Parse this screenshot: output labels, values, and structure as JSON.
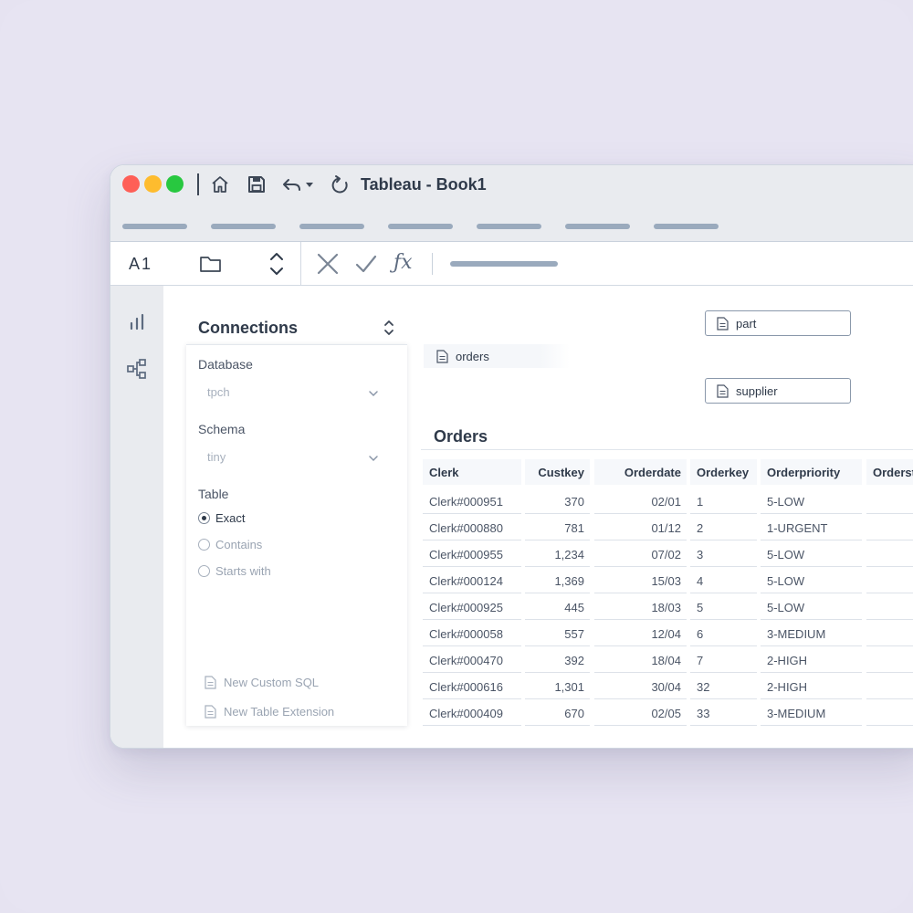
{
  "window": {
    "title": "Tableau - Book1"
  },
  "formula_bar": {
    "cell_ref": "A1",
    "fx_label": "ƒx"
  },
  "connections": {
    "title": "Connections",
    "database": {
      "label": "Database",
      "value": "tpch"
    },
    "schema": {
      "label": "Schema",
      "value": "tiny"
    },
    "table": {
      "label": "Table",
      "options": [
        {
          "label": "Exact",
          "checked": true
        },
        {
          "label": "Contains",
          "checked": false
        },
        {
          "label": "Starts with",
          "checked": false
        }
      ]
    },
    "new_custom_sql": "New Custom SQL",
    "new_table_extension": "New Table Extension"
  },
  "canvas": {
    "tables": {
      "part": "part",
      "orders": "orders",
      "supplier": "supplier"
    }
  },
  "grid": {
    "title": "Orders",
    "columns": [
      "Clerk",
      "Custkey",
      "Orderdate",
      "Orderkey",
      "Orderpriority",
      "Orderst"
    ],
    "rows": [
      [
        "Clerk#000951",
        "370",
        "02/01",
        "1",
        "5-LOW"
      ],
      [
        "Clerk#000880",
        "781",
        "01/12",
        "2",
        "1-URGENT"
      ],
      [
        "Clerk#000955",
        "1,234",
        "07/02",
        "3",
        "5-LOW"
      ],
      [
        "Clerk#000124",
        "1,369",
        "15/03",
        "4",
        "5-LOW"
      ],
      [
        "Clerk#000925",
        "445",
        "18/03",
        "5",
        "5-LOW"
      ],
      [
        "Clerk#000058",
        "557",
        "12/04",
        "6",
        "3-MEDIUM"
      ],
      [
        "Clerk#000470",
        "392",
        "18/04",
        "7",
        "2-HIGH"
      ],
      [
        "Clerk#000616",
        "1,301",
        "30/04",
        "32",
        "2-HIGH"
      ],
      [
        "Clerk#000409",
        "670",
        "02/05",
        "33",
        "3-MEDIUM"
      ]
    ]
  },
  "icons": {
    "home": "home-icon",
    "save": "save-icon",
    "undo": "undo-icon",
    "refresh": "refresh-icon",
    "folder": "folder-icon",
    "cancel": "close-icon",
    "confirm": "check-icon",
    "chart": "bar-chart-icon",
    "data_source": "data-source-icon",
    "file": "file-icon"
  },
  "colors": {
    "traffic_red": "#fe5f57",
    "traffic_yellow": "#febc2e",
    "traffic_green": "#28c840",
    "text": "#2f3a4a",
    "muted": "#9aa4b2",
    "background": "#e7e4f2"
  }
}
